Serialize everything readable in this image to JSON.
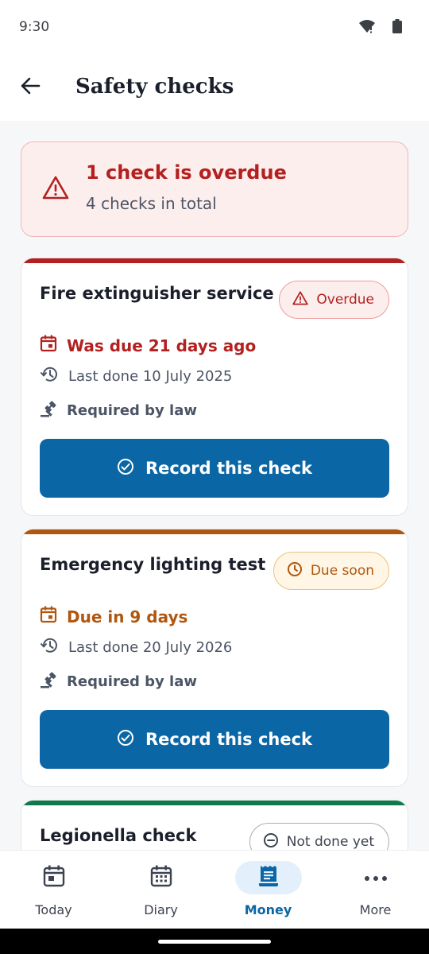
{
  "status_bar": {
    "time": "9:30"
  },
  "header": {
    "title": "Safety checks"
  },
  "alert": {
    "title": "1 check is overdue",
    "subtitle": "4 checks in total"
  },
  "checks": [
    {
      "title": "Fire extinguisher service",
      "status": "Overdue",
      "due_text": "Was due 21 days ago",
      "last_done": "Last done 10 July 2025",
      "requirement": "Required by law",
      "button_label": "Record this check",
      "accent_color": "#b3201f"
    },
    {
      "title": "Emergency lighting test",
      "status": "Due soon",
      "due_text": "Due in 9 days",
      "last_done": "Last done 20 July 2026",
      "requirement": "Required by law",
      "button_label": "Record this check",
      "accent_color": "#b0560e"
    },
    {
      "title": "Legionella check",
      "status": "Not done yet",
      "accent_color": "#0e7a4a"
    }
  ],
  "bottom_nav": {
    "items": [
      {
        "label": "Today",
        "icon": "calendar-today-icon"
      },
      {
        "label": "Diary",
        "icon": "calendar-month-icon"
      },
      {
        "label": "Money",
        "icon": "receipt-icon",
        "active": true
      },
      {
        "label": "More",
        "icon": "more-horizontal-icon"
      }
    ]
  },
  "colors": {
    "primary": "#0a66a5",
    "overdue": "#b3201f",
    "due_soon": "#b0560e",
    "ok": "#0e7a4a"
  }
}
